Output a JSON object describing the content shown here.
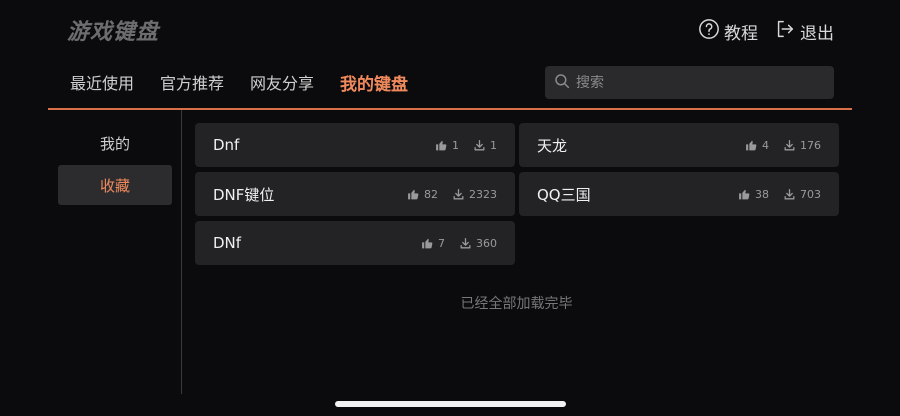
{
  "header": {
    "logo": "游戏键盘",
    "tutorial_label": "教程",
    "exit_label": "退出"
  },
  "tabs": [
    {
      "label": "最近使用",
      "active": false
    },
    {
      "label": "官方推荐",
      "active": false
    },
    {
      "label": "网友分享",
      "active": false
    },
    {
      "label": "我的键盘",
      "active": true
    }
  ],
  "search": {
    "placeholder": "搜索"
  },
  "sidebar": {
    "items": [
      {
        "label": "我的",
        "active": false
      },
      {
        "label": "收藏",
        "active": true
      }
    ]
  },
  "cards": [
    {
      "name": "Dnf",
      "likes": "1",
      "downloads": "1"
    },
    {
      "name": "天龙",
      "likes": "4",
      "downloads": "176"
    },
    {
      "name": "DNF键位",
      "likes": "82",
      "downloads": "2323"
    },
    {
      "name": "QQ三国",
      "likes": "38",
      "downloads": "703"
    },
    {
      "name": "DNf",
      "likes": "7",
      "downloads": "360"
    }
  ],
  "footer": {
    "status": "已经全部加载完毕"
  },
  "colors": {
    "accent": "#f08a5d",
    "background": "#0b0b0d",
    "card": "#232326"
  },
  "icons": {
    "tutorial": "question-circle-icon",
    "exit": "logout-icon",
    "search": "search-icon",
    "like": "thumbs-up-icon",
    "download": "download-icon"
  }
}
